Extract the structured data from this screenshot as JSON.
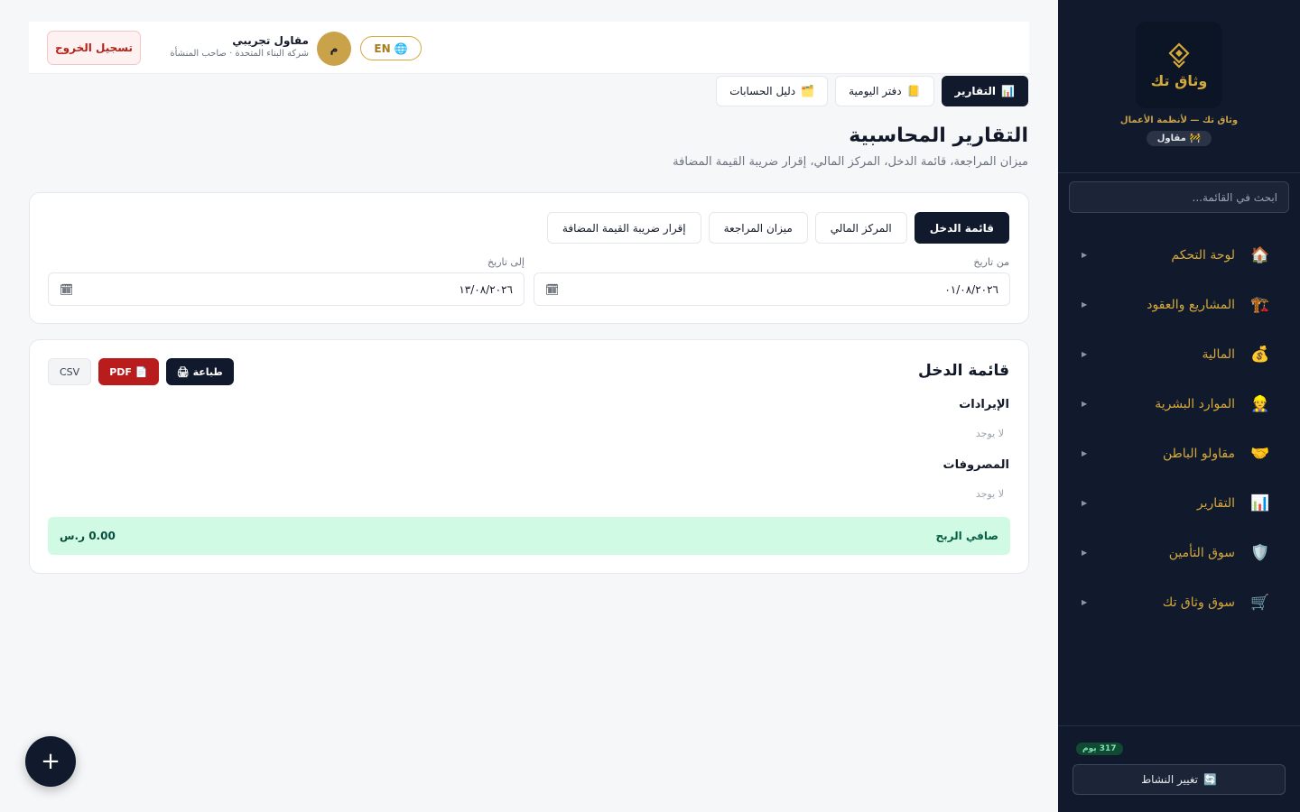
{
  "brand": {
    "logo_text": "وثاق تك",
    "tagline": "وثاق تك — لأنظمة الأعمال",
    "role_badge": "مقاول",
    "role_icon": "construction-icon"
  },
  "sidebar": {
    "search_placeholder": "ابحث في القائمة...",
    "items": [
      {
        "label": "لوحة التحكم",
        "icon": "🏠",
        "icon_name": "home-icon"
      },
      {
        "label": "المشاريع والعقود",
        "icon": "🏗️",
        "icon_name": "crane-icon"
      },
      {
        "label": "المالية",
        "icon": "💰",
        "icon_name": "money-bag-icon"
      },
      {
        "label": "الموارد البشرية",
        "icon": "👷",
        "icon_name": "worker-icon"
      },
      {
        "label": "مقاولو الباطن",
        "icon": "🤝",
        "icon_name": "handshake-icon"
      },
      {
        "label": "التقارير",
        "icon": "📊",
        "icon_name": "bar-chart-icon"
      },
      {
        "label": "سوق التأمين",
        "icon": "🛡️",
        "icon_name": "shield-icon"
      },
      {
        "label": "سوق وثاق تك",
        "icon": "🛒",
        "icon_name": "cart-icon"
      }
    ],
    "days_badge": "317 يوم",
    "switch_label": "تغيير النشاط",
    "switch_icon": "🔄"
  },
  "topbar": {
    "logout_label": "تسجيل الخروج",
    "lang_label": "EN",
    "avatar_initial": "م",
    "user_name": "مقاول تجريبي",
    "user_sub": "شركة البناء المتحدة · صاحب المنشأة"
  },
  "section_tabs": [
    {
      "label": "التقارير",
      "icon": "📊",
      "active": true
    },
    {
      "label": "دفتر اليومية",
      "icon": "📒",
      "active": false
    },
    {
      "label": "دليل الحسابات",
      "icon": "🗂️",
      "active": false
    }
  ],
  "page": {
    "title": "التقارير المحاسبية",
    "subtitle": "ميزان المراجعة، قائمة الدخل، المركز المالي، إقرار ضريبة القيمة المضافة"
  },
  "report_tabs": [
    {
      "label": "قائمة الدخل",
      "active": true
    },
    {
      "label": "المركز المالي",
      "active": false
    },
    {
      "label": "ميزان المراجعة",
      "active": false
    },
    {
      "label": "إقرار ضريبة القيمة المضافة",
      "active": false
    }
  ],
  "filters": {
    "from_label": "من تاريخ",
    "from_value": "٠١/٠٨/٢٠٢٦",
    "to_label": "إلى تاريخ",
    "to_value": "١٣/٠٨/٢٠٢٦"
  },
  "income": {
    "title": "قائمة الدخل",
    "print_label": "طباعة",
    "pdf_label": "PDF",
    "csv_label": "CSV",
    "revenue_heading": "الإيرادات",
    "revenue_empty": "لا يوجد",
    "expense_heading": "المصروفات",
    "expense_empty": "لا يوجد",
    "net_label": "صافي الربح",
    "net_value": "0.00 ر.س"
  },
  "fab_label": "+",
  "colors": {
    "sidebar_bg": "#111a2c",
    "accent_gold": "#d4a83a",
    "danger": "#b91c1c",
    "success_bg": "#d1fae5"
  }
}
